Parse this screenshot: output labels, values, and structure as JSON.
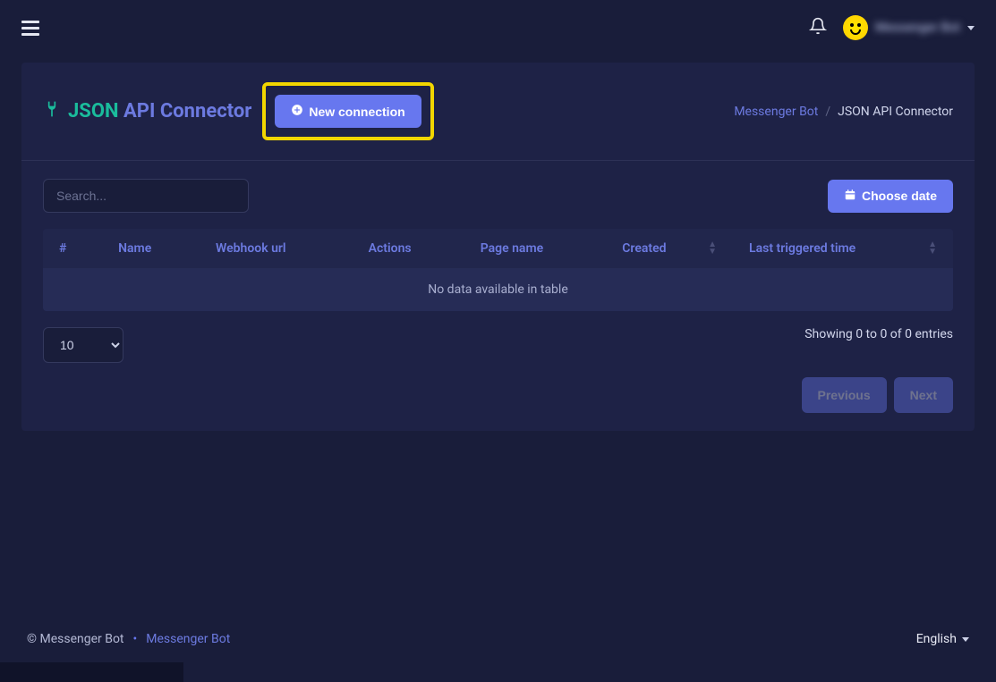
{
  "header": {
    "user_name": "Messenger Bot"
  },
  "page": {
    "title_json": "JSON",
    "title_rest": "API Connector",
    "new_connection_label": "New connection"
  },
  "breadcrumb": {
    "link_label": "Messenger Bot",
    "current": "JSON API Connector"
  },
  "toolbar": {
    "search_placeholder": "Search...",
    "choose_date_label": "Choose date"
  },
  "table": {
    "columns": [
      "#",
      "Name",
      "Webhook url",
      "Actions",
      "Page name",
      "Created",
      "Last triggered time"
    ],
    "empty_message": "No data available in table"
  },
  "pagination": {
    "length_value": "10",
    "info": "Showing 0 to 0 of 0 entries",
    "prev_label": "Previous",
    "next_label": "Next"
  },
  "footer": {
    "copyright": "© Messenger Bot",
    "link_label": "Messenger Bot",
    "language": "English"
  }
}
